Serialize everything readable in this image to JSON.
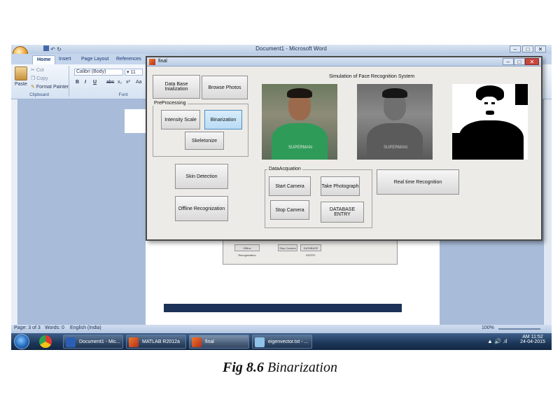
{
  "word": {
    "title": "Document1 - Microsoft Word",
    "tabs": [
      "Home",
      "Insert",
      "Page Layout",
      "References"
    ],
    "clipboard": {
      "paste": "Paste",
      "cut": "Cut",
      "copy": "Copy",
      "format_painter": "Format Painter",
      "group": "Clipboard"
    },
    "font": {
      "name": "Calibri (Body)",
      "size": "11",
      "group": "Font"
    },
    "status": {
      "page": "Page: 3 of 3",
      "words": "Words: 0",
      "language": "English (India)",
      "zoom": "100%"
    }
  },
  "taskbar": {
    "items": [
      "Document1 - Mic...",
      "MATLAB R2012a",
      "final",
      "eigenvector.txt - ..."
    ],
    "time": "AM 11:52",
    "date": "24-04-2015"
  },
  "figure": {
    "window_title": "final",
    "heading": "Simulation of Face Recognition System",
    "buttons": {
      "db_init": "Data Base Inialization",
      "browse": "Browse Photos",
      "skin": "Skin Detection",
      "offline": "Offline Recognization",
      "realtime": "Real time Recognition"
    },
    "preprocessing": {
      "title": "PreProcessing",
      "intensity": "Intensity Scale",
      "binarization": "Binarization",
      "skeletonize": "Skeletonize"
    },
    "acquisition": {
      "title": "DataAcquation",
      "start": "Start Camera",
      "take": "Take Photograph",
      "stop": "Stop Camera",
      "db_entry": "DATABASE ENTRY"
    },
    "photo_shirt_text": "SUPERMAN"
  },
  "ghost": {
    "buttons": [
      "Offline Recognization",
      "Stop Camera",
      "DATABASE ENTRY"
    ]
  },
  "caption": {
    "label": "Fig 8.6",
    "text": "Binarization"
  }
}
